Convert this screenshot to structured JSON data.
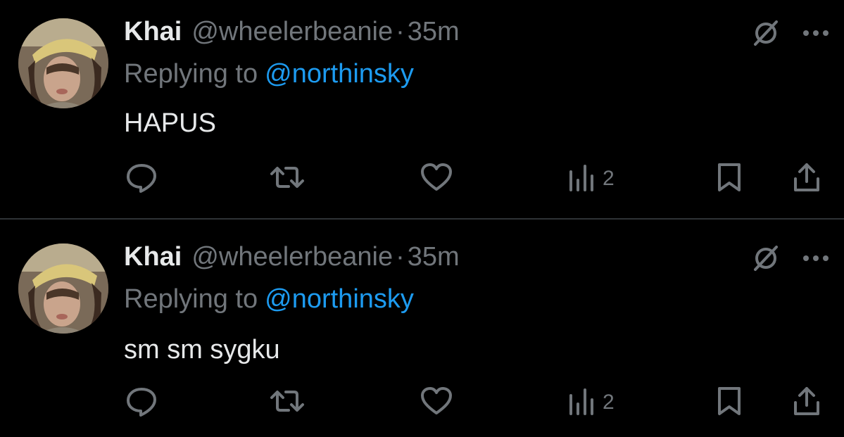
{
  "tweets": [
    {
      "author_name": "Khai",
      "author_handle": "@wheelerbeanie",
      "separator": "·",
      "time": "35m",
      "reply_prefix": "Replying to",
      "reply_target": "@northinsky",
      "text": "HAPUS",
      "views_count": "2",
      "icons": [
        "grok-icon",
        "more-icon",
        "reply-icon",
        "retweet-icon",
        "like-icon",
        "views-icon",
        "bookmark-icon",
        "share-icon"
      ]
    },
    {
      "author_name": "Khai",
      "author_handle": "@wheelerbeanie",
      "separator": "·",
      "time": "35m",
      "reply_prefix": "Replying to",
      "reply_target": "@northinsky",
      "text": "sm sm sygku",
      "views_count": "2",
      "icons": [
        "grok-icon",
        "more-icon",
        "reply-icon",
        "retweet-icon",
        "like-icon",
        "views-icon",
        "bookmark-icon",
        "share-icon"
      ]
    }
  ],
  "colors": {
    "background": "#000000",
    "primary_text": "#e7e9ea",
    "secondary_text": "#71767b",
    "link": "#1d9bf0",
    "divider": "#2f3336"
  }
}
